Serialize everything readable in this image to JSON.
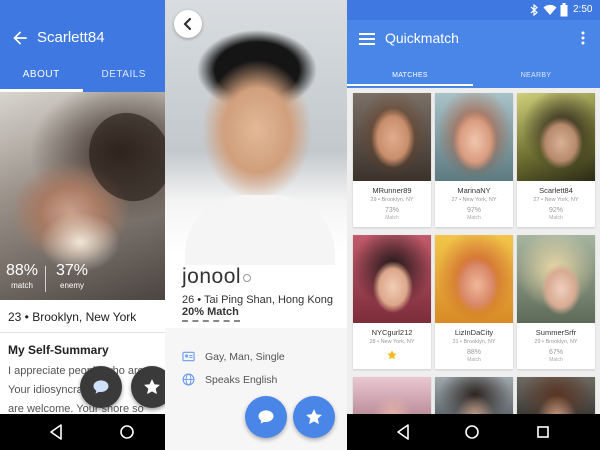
{
  "profile_screen": {
    "title": "Scarlett84",
    "tabs": [
      "ABOUT",
      "DETAILS"
    ],
    "match_percent": "88%",
    "match_label": "match",
    "enemy_percent": "37%",
    "enemy_label": "enemy",
    "age_location": "23 • Brooklyn, New York",
    "section_title": "My Self-Summary",
    "summary_lines": [
      "I appreciate people who are",
      "Your idiosyncrasies are",
      "are welcome. Your shore so"
    ]
  },
  "detail_screen": {
    "username": "jonool",
    "age_location": "26 • Tai Ping Shan, Hong Kong",
    "match": "20% Match",
    "orientation": "Gay, Man, Single",
    "languages": "Speaks English"
  },
  "quickmatch_screen": {
    "status_time": "2:50",
    "title": "Quickmatch",
    "tabs": [
      "MATCHES",
      "NEARBY"
    ],
    "match_label": "Match",
    "cards": [
      {
        "name": "MRunner89",
        "location": "29 • Brooklyn, NY",
        "percent": "73%",
        "starred": false
      },
      {
        "name": "MarinaNY",
        "location": "27 • New York, NY",
        "percent": "97%",
        "starred": false
      },
      {
        "name": "Scarlett84",
        "location": "27 • New York, NY",
        "percent": "92%",
        "starred": false
      },
      {
        "name": "NYCgurl212",
        "location": "28 • New York, NY",
        "percent": "",
        "starred": true
      },
      {
        "name": "LizInDaCity",
        "location": "31 • Brooklyn, NY",
        "percent": "88%",
        "starred": false
      },
      {
        "name": "SummerSrfr",
        "location": "29 • Brooklyn, NY",
        "percent": "67%",
        "starred": false
      }
    ]
  }
}
